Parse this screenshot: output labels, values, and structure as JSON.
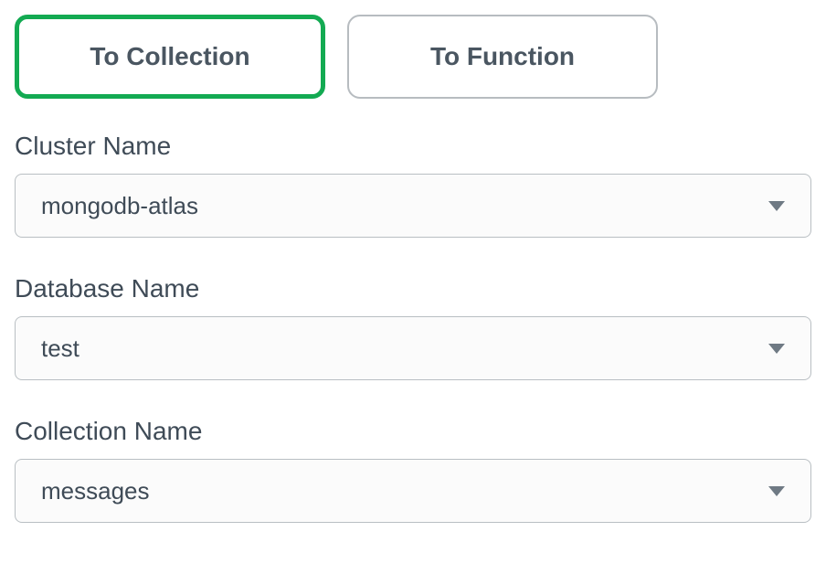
{
  "tabs": {
    "to_collection": "To Collection",
    "to_function": "To Function"
  },
  "fields": {
    "cluster": {
      "label": "Cluster Name",
      "value": "mongodb-atlas"
    },
    "database": {
      "label": "Database Name",
      "value": "test"
    },
    "collection": {
      "label": "Collection Name",
      "value": "messages"
    }
  }
}
